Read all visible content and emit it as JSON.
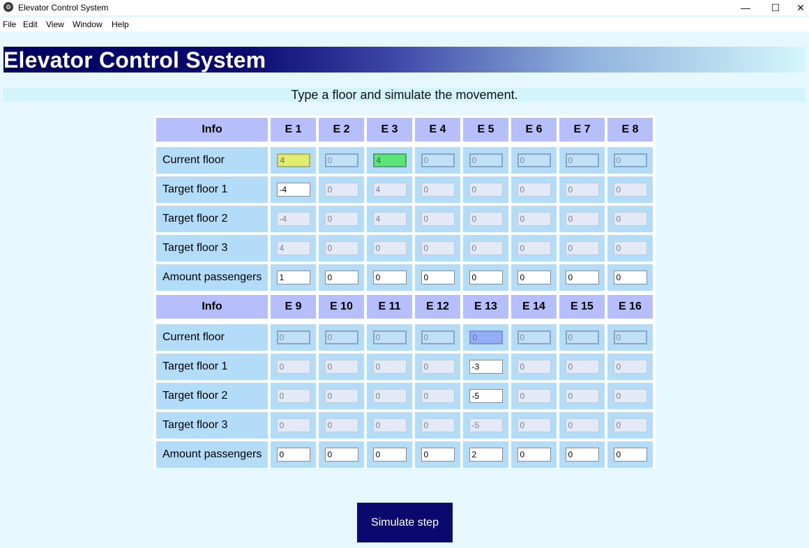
{
  "window": {
    "title": "Elevator Control System",
    "controls": {
      "minimize": "—",
      "maximize": "☐",
      "close": "✕"
    }
  },
  "menu": [
    "File",
    "Edit",
    "View",
    "Window",
    "Help"
  ],
  "header": {
    "title": "Elevator Control System",
    "subtitle": "Type a floor and simulate the movement."
  },
  "tables": [
    {
      "info_label": "Info",
      "elevators": [
        "E 1",
        "E 2",
        "E 3",
        "E 4",
        "E 5",
        "E 6",
        "E 7",
        "E 8"
      ],
      "rows": [
        {
          "label": "Current floor",
          "kind": "current",
          "values": [
            "4",
            "0",
            "4",
            "0",
            "0",
            "0",
            "0",
            "0"
          ],
          "states": [
            "yellow",
            "cur",
            "green",
            "cur",
            "cur",
            "cur",
            "cur",
            "cur"
          ]
        },
        {
          "label": "Target floor 1",
          "kind": "target",
          "values": [
            "-4",
            "0",
            "4",
            "0",
            "0",
            "0",
            "0",
            "0"
          ],
          "states": [
            "edit",
            "dis",
            "dis",
            "dis",
            "dis",
            "dis",
            "dis",
            "dis"
          ]
        },
        {
          "label": "Target floor 2",
          "kind": "target",
          "values": [
            "-4",
            "0",
            "4",
            "0",
            "0",
            "0",
            "0",
            "0"
          ],
          "states": [
            "dis",
            "dis",
            "dis",
            "dis",
            "dis",
            "dis",
            "dis",
            "dis"
          ]
        },
        {
          "label": "Target floor 3",
          "kind": "target",
          "values": [
            "4",
            "0",
            "0",
            "0",
            "0",
            "0",
            "0",
            "0"
          ],
          "states": [
            "dis",
            "dis",
            "dis",
            "dis",
            "dis",
            "dis",
            "dis",
            "dis"
          ]
        },
        {
          "label": "Amount passengers",
          "kind": "passengers",
          "values": [
            "1",
            "0",
            "0",
            "0",
            "0",
            "0",
            "0",
            "0"
          ],
          "states": [
            "edit",
            "edit",
            "edit",
            "edit",
            "edit",
            "edit",
            "edit",
            "edit"
          ]
        }
      ]
    },
    {
      "info_label": "Info",
      "elevators": [
        "E 9",
        "E 10",
        "E 11",
        "E 12",
        "E 13",
        "E 14",
        "E 15",
        "E 16"
      ],
      "rows": [
        {
          "label": "Current floor",
          "kind": "current",
          "values": [
            "0",
            "0",
            "0",
            "0",
            "0",
            "0",
            "0",
            "0"
          ],
          "states": [
            "cur",
            "cur",
            "cur",
            "cur",
            "blue",
            "cur",
            "cur",
            "cur"
          ]
        },
        {
          "label": "Target floor 1",
          "kind": "target",
          "values": [
            "0",
            "0",
            "0",
            "0",
            "-3",
            "0",
            "0",
            "0"
          ],
          "states": [
            "dis",
            "dis",
            "dis",
            "dis",
            "edit",
            "dis",
            "dis",
            "dis"
          ]
        },
        {
          "label": "Target floor 2",
          "kind": "target",
          "values": [
            "0",
            "0",
            "0",
            "0",
            "-5",
            "0",
            "0",
            "0"
          ],
          "states": [
            "dis",
            "dis",
            "dis",
            "dis",
            "edit",
            "dis",
            "dis",
            "dis"
          ]
        },
        {
          "label": "Target floor 3",
          "kind": "target",
          "values": [
            "0",
            "0",
            "0",
            "0",
            "-5",
            "0",
            "0",
            "0"
          ],
          "states": [
            "dis",
            "dis",
            "dis",
            "dis",
            "dis",
            "dis",
            "dis",
            "dis"
          ]
        },
        {
          "label": "Amount passengers",
          "kind": "passengers",
          "values": [
            "0",
            "0",
            "0",
            "0",
            "2",
            "0",
            "0",
            "0"
          ],
          "states": [
            "edit",
            "edit",
            "edit",
            "edit",
            "edit",
            "edit",
            "edit",
            "edit"
          ]
        }
      ]
    }
  ],
  "actions": {
    "simulate_label": "Simulate step"
  },
  "colors": {
    "banner_start": "#000060",
    "banner_end": "#d4f6fc",
    "header_cell": "#b6bffb",
    "body_cell": "#b3dcf9",
    "highlight_yellow": "#e2ec6f",
    "highlight_green": "#5be478",
    "highlight_blue": "#93adf9",
    "button": "#0a0a6e"
  }
}
